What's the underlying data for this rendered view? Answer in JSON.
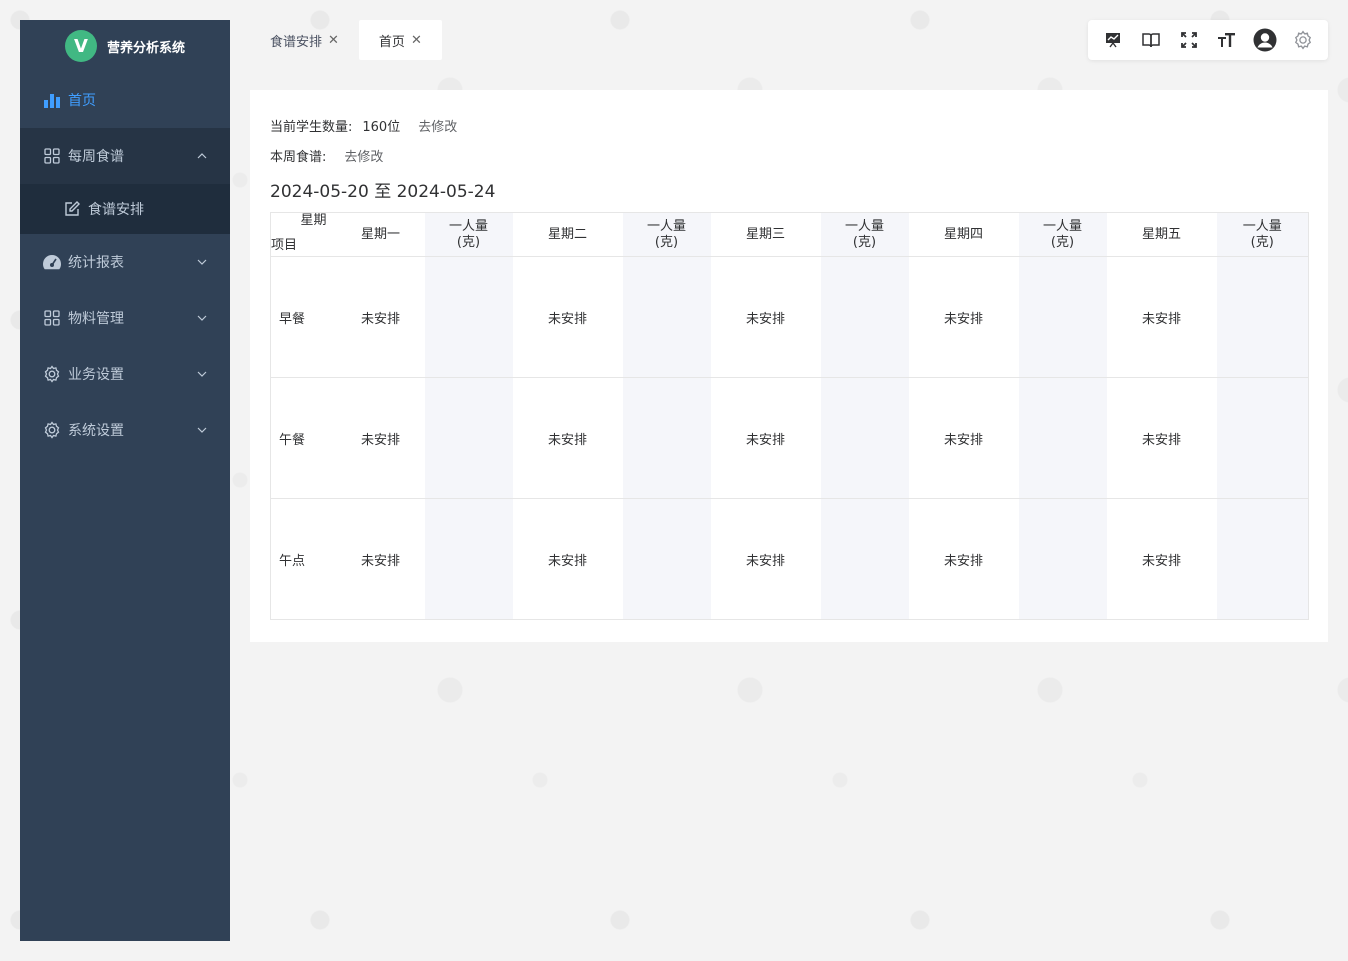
{
  "app": {
    "logo_letter": "V",
    "title": "营养分析系统"
  },
  "sidebar": {
    "items": [
      {
        "label": "首页",
        "icon": "bar-chart-icon",
        "active": true
      },
      {
        "label": "每周食谱",
        "icon": "grid-icon",
        "expanded": true
      },
      {
        "label": "食谱安排",
        "icon": "edit-icon",
        "sub": true
      },
      {
        "label": "统计报表",
        "icon": "dashboard-icon"
      },
      {
        "label": "物料管理",
        "icon": "grid-icon"
      },
      {
        "label": "业务设置",
        "icon": "gear-icon"
      },
      {
        "label": "系统设置",
        "icon": "gear-icon"
      }
    ]
  },
  "tabs": [
    {
      "label": "食谱安排",
      "active": false
    },
    {
      "label": "首页",
      "active": true
    }
  ],
  "toolbar": [
    "presentation-icon",
    "book-icon",
    "fullscreen-icon",
    "font-size-icon",
    "user-avatar-icon",
    "settings-icon"
  ],
  "main": {
    "student_label": "当前学生数量:",
    "student_count": "160位",
    "edit_link": "去修改",
    "menu_label": "本周食谱:",
    "menu_edit_link": "去修改",
    "week_range": "2024-05-20 至 2024-05-24"
  },
  "table": {
    "corner_top": "星期",
    "corner_bottom": "项目",
    "days": [
      "星期一",
      "星期二",
      "星期三",
      "星期四",
      "星期五"
    ],
    "portion_header_line1": "一人量",
    "portion_header_line2": "(克)",
    "rows": [
      {
        "label": "早餐",
        "cells": [
          "未安排",
          "未安排",
          "未安排",
          "未安排",
          "未安排"
        ]
      },
      {
        "label": "午餐",
        "cells": [
          "未安排",
          "未安排",
          "未安排",
          "未安排",
          "未安排"
        ]
      },
      {
        "label": "午点",
        "cells": [
          "未安排",
          "未安排",
          "未安排",
          "未安排",
          "未安排"
        ]
      }
    ]
  },
  "colors": {
    "sidebar_bg": "#304156",
    "active": "#409eff",
    "logo": "#41b883"
  }
}
